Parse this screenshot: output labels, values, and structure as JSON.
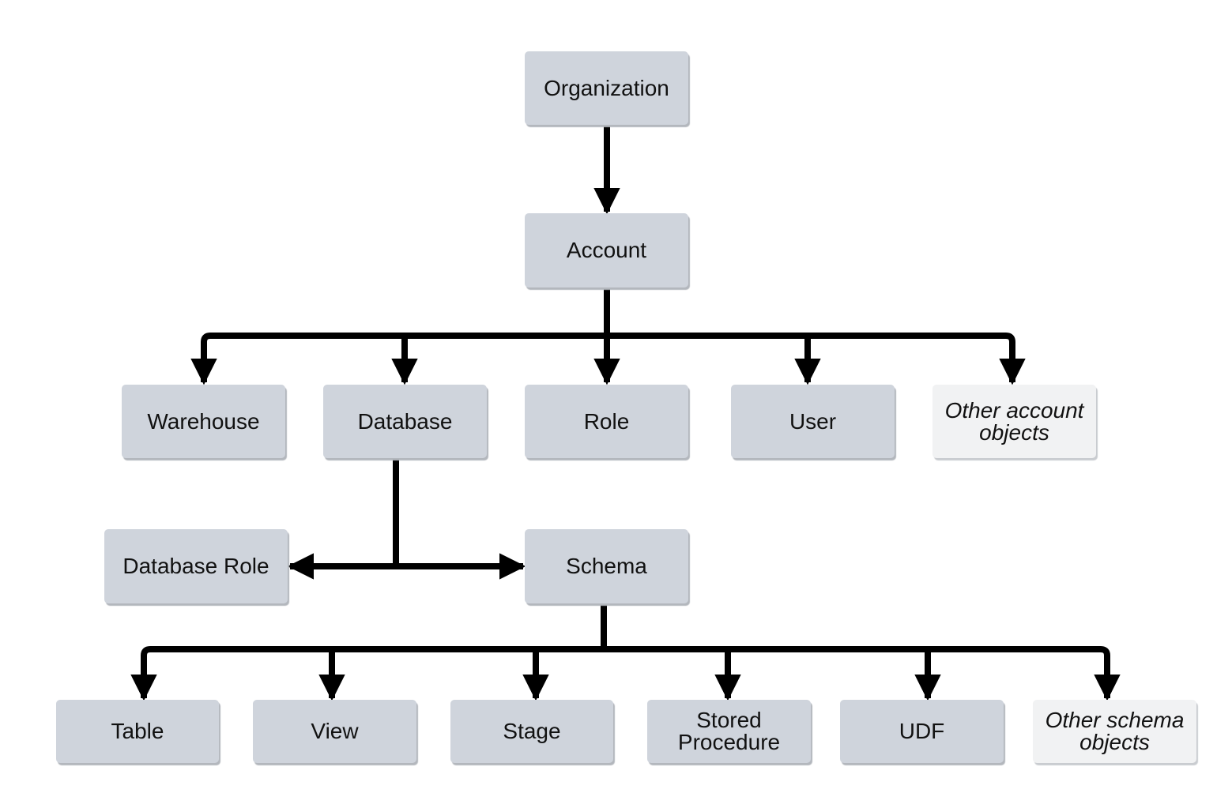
{
  "diagram": {
    "title": "",
    "colors": {
      "node_fill": "#cfd4dc",
      "other_node_fill": "#f1f2f3",
      "connector": "#000000",
      "text": "#111111"
    },
    "nodes": {
      "organization": {
        "label": "Organization"
      },
      "account": {
        "label": "Account"
      },
      "warehouse": {
        "label": "Warehouse"
      },
      "database": {
        "label": "Database"
      },
      "role": {
        "label": "Role"
      },
      "user": {
        "label": "User"
      },
      "other_account": {
        "label_line1": "Other account",
        "label_line2": "objects",
        "style": "italic"
      },
      "database_role": {
        "label": "Database Role"
      },
      "schema": {
        "label": "Schema"
      },
      "table": {
        "label": "Table"
      },
      "view": {
        "label": "View"
      },
      "stage": {
        "label": "Stage"
      },
      "stored_procedure": {
        "label_line1": "Stored",
        "label_line2": "Procedure"
      },
      "udf": {
        "label": "UDF"
      },
      "other_schema": {
        "label_line1": "Other schema",
        "label_line2": "objects",
        "style": "italic"
      }
    },
    "edges": [
      {
        "from": "Organization",
        "to": "Account"
      },
      {
        "from": "Account",
        "to": "Warehouse"
      },
      {
        "from": "Account",
        "to": "Database"
      },
      {
        "from": "Account",
        "to": "Role"
      },
      {
        "from": "Account",
        "to": "User"
      },
      {
        "from": "Account",
        "to": "Other account objects"
      },
      {
        "from": "Database",
        "to": "Database Role"
      },
      {
        "from": "Database",
        "to": "Schema"
      },
      {
        "from": "Schema",
        "to": "Table"
      },
      {
        "from": "Schema",
        "to": "View"
      },
      {
        "from": "Schema",
        "to": "Stage"
      },
      {
        "from": "Schema",
        "to": "Stored Procedure"
      },
      {
        "from": "Schema",
        "to": "UDF"
      },
      {
        "from": "Schema",
        "to": "Other schema objects"
      }
    ]
  }
}
